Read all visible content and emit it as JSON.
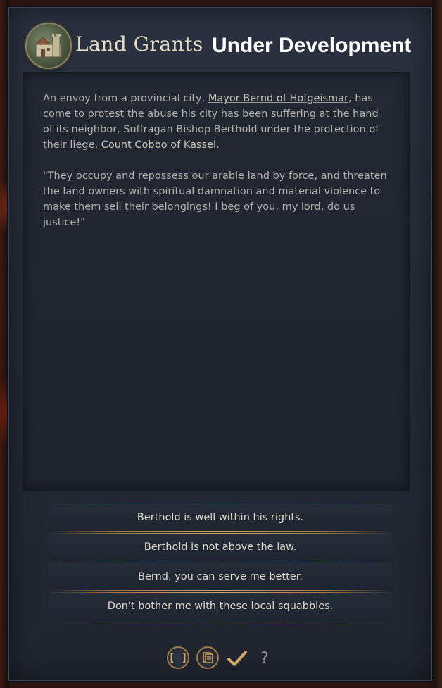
{
  "event": {
    "title": "Land Grants",
    "dev_label": "Under Development",
    "emblem_icon": "castle-icon",
    "paragraph1": {
      "before_link1": "An envoy from a provincial city, ",
      "link1": "Mayor Bernd of Hofgeismar",
      "between": ", has come to protest the abuse his city has been suffering at the hand of its neighbor, Suffragan Bishop Berthold under the protection of their liege, ",
      "link2": "Count Cobbo of Kassel",
      "after": "."
    },
    "paragraph2": "\"They occupy and repossess our arable land by force, and threaten the land owners with spiritual damnation and material violence to make them sell their belongings! I beg of you, my lord, do us justice!\""
  },
  "options": [
    {
      "label": "Berthold is well within his rights."
    },
    {
      "label": "Berthold is not above the law."
    },
    {
      "label": "Bernd, you can serve me better."
    },
    {
      "label": "Don't bother me with these local squabbles."
    }
  ],
  "footer": {
    "bracket_label": "[ ]",
    "help_label": "?",
    "icons": [
      "brackets-icon",
      "scroll-icon",
      "checkmark-icon",
      "question-icon"
    ]
  },
  "colors": {
    "panel": "#262c38",
    "gold_accent": "#d2a865",
    "title_text": "#e3dcc3"
  }
}
